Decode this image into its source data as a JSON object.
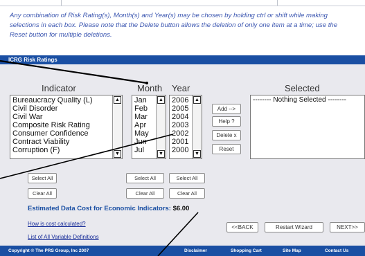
{
  "intro_text": "Any combination of Risk Rating(s), Month(s) and Year(s) may be chosen by holding ctrl or shift while making selections in each box.  Please note that the Delete button allows the deletion of only one item at a time; use the Reset button for multiple deletions.",
  "section_title": "ICRG Risk Ratings",
  "headers": {
    "indicator": "Indicator",
    "month": "Month",
    "year": "Year",
    "selected": "Selected"
  },
  "indicator_items": [
    "Bureaucracy Quality (L)",
    "Civil Disorder",
    "Civil War",
    "Composite Risk Rating",
    "Consumer Confidence",
    "Contract Viability",
    "Corruption (F)"
  ],
  "month_items": [
    "Jan",
    "Feb",
    "Mar",
    "Apr",
    "May",
    "Jun",
    "Jul"
  ],
  "year_items": [
    "2006",
    "2005",
    "2004",
    "2003",
    "2002",
    "2001",
    "2000"
  ],
  "selected_placeholder": "-------- Nothing Selected --------",
  "buttons": {
    "add": "Add -->",
    "help": "Help ?",
    "delete": "Delete x",
    "reset": "Reset",
    "select_all": "Select All",
    "clear_all": "Clear All",
    "back": "<<BACK",
    "restart": "Restart Wizard",
    "next": "NEXT>>"
  },
  "cost": {
    "label": "Estimated Data Cost for Economic Indicators:",
    "value": "$6.00"
  },
  "links": {
    "how_cost": "How is cost calculated?",
    "variable_defs": "List of All Variable Definitions"
  },
  "footer": {
    "copyright": "Copyright  © The PRS Group, Inc 2007",
    "disclaimer": "Disclaimer",
    "cart": "Shopping Cart",
    "sitemap": "Site Map",
    "contact": "Contact Us"
  },
  "colors": {
    "accent": "#1a4fa3",
    "panel": "#e9e9ee",
    "intro_text": "#3a55b0"
  }
}
